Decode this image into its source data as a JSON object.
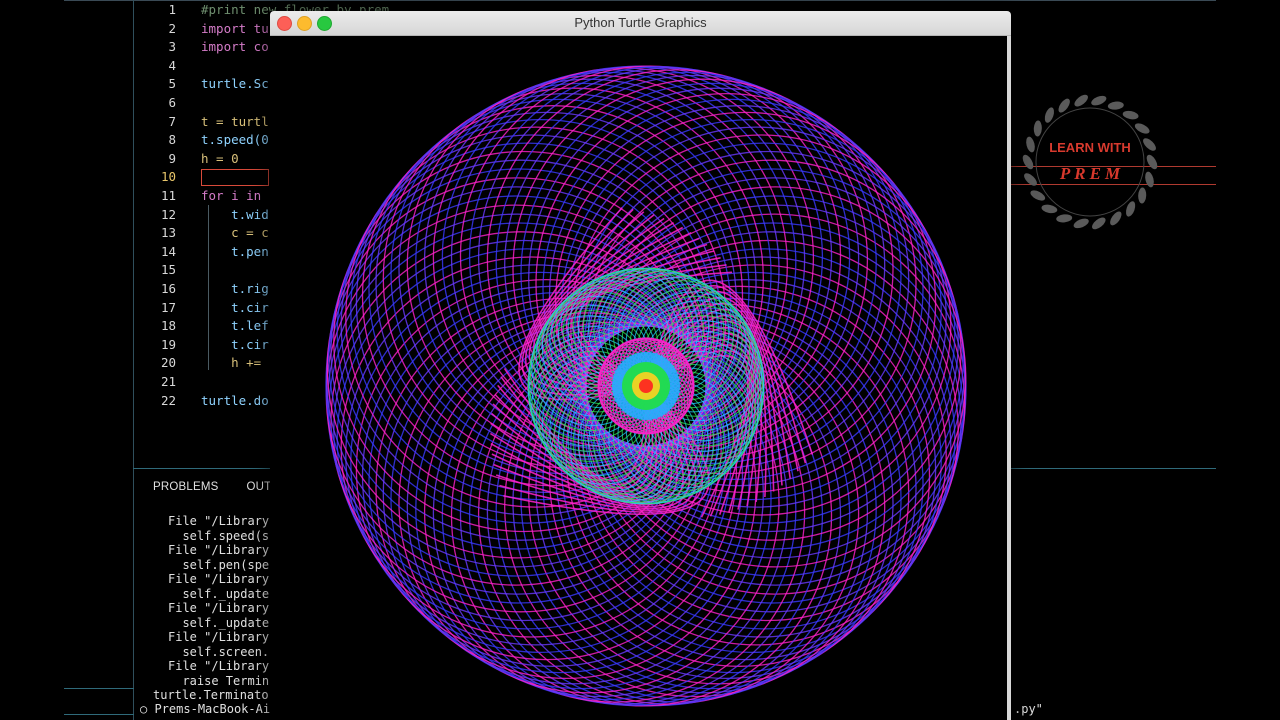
{
  "window": {
    "title": "Python Turtle Graphics"
  },
  "editor": {
    "line_numbers": [
      "1",
      "2",
      "3",
      "4",
      "5",
      "6",
      "7",
      "8",
      "9",
      "10",
      "11",
      "12",
      "13",
      "14",
      "15",
      "16",
      "17",
      "18",
      "19",
      "20",
      "21",
      "22"
    ],
    "lines": [
      "#print new flower by prem",
      "import tu",
      "import co",
      "",
      "turtle.Sc",
      "",
      "t = turtl",
      "t.speed(0",
      "h = 0",
      "",
      "for i in",
      "    t.wid",
      "    c = c",
      "    t.pen",
      "",
      "    t.rig",
      "    t.cir",
      "    t.lef",
      "    t.cir",
      "    h +=",
      "",
      "turtle.do"
    ]
  },
  "panel": {
    "tabs": [
      "PROBLEMS",
      "OUTP"
    ],
    "terminal_lines": [
      "File \"/Library",
      "  self.speed(s",
      "File \"/Library",
      "  self.pen(spe",
      "File \"/Library",
      "  self._update",
      "File \"/Library",
      "  self._update",
      "File \"/Library",
      "  self.screen.",
      "File \"/Library",
      "  raise Termin",
      "turtle.Terminato"
    ],
    "prompt": "Prems-MacBook-Ai",
    "prompt_symbol": "○",
    "right_fragment": ".py\""
  },
  "logo": {
    "line1": "LEARN WITH",
    "line2": "PREM"
  },
  "drawing": {
    "outer_color": "#ff22cc",
    "ring_colors": [
      "#3a3aff",
      "#6a3aff",
      "#1fd0ff",
      "#2ee85a"
    ],
    "center_colors": [
      "#ff2020",
      "#ffd020",
      "#20e040",
      "#20b0ff"
    ]
  }
}
